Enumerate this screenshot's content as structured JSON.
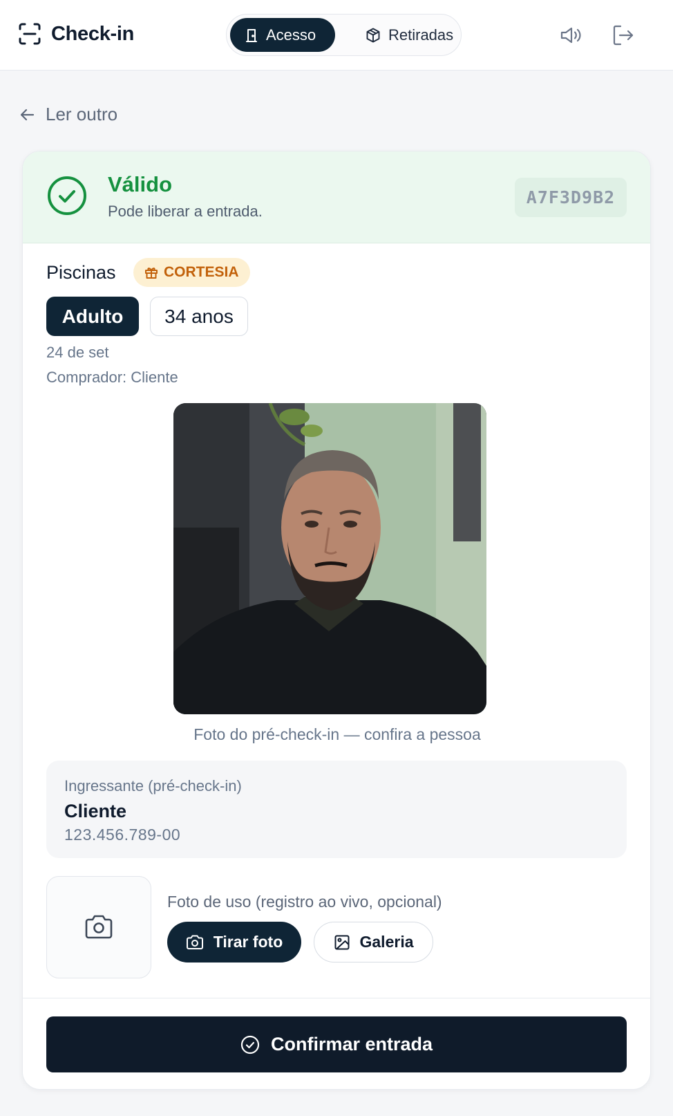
{
  "header": {
    "title": "Check-in",
    "tabs": [
      {
        "label": "Acesso",
        "active": true,
        "icon": "door-icon"
      },
      {
        "label": "Retiradas",
        "active": false,
        "icon": "package-icon"
      }
    ],
    "actions": [
      {
        "icon": "speaker-icon"
      },
      {
        "icon": "logout-icon"
      }
    ]
  },
  "back": {
    "label": "Ler outro"
  },
  "status": {
    "title": "Válido",
    "subtitle": "Pode liberar a entrada.",
    "code": "A7F3D9B2",
    "color": "#15913f",
    "background": "#ebf8ef"
  },
  "ticket": {
    "product": "Piscinas",
    "badge": "CORTESIA",
    "badge_color": "#c2610a",
    "category": "Adulto",
    "age": "34 anos",
    "date": "24 de set",
    "buyer": "Comprador: Cliente"
  },
  "photo": {
    "caption": "Foto do pré-check-in — confira a pessoa"
  },
  "entrant": {
    "label": "Ingressante (pré-check-in)",
    "name": "Cliente",
    "document": "123.456.789-00"
  },
  "usage_photo": {
    "label": "Foto de uso (registro ao vivo, opcional)",
    "take_photo": "Tirar foto",
    "gallery": "Galeria"
  },
  "confirm": {
    "label": "Confirmar entrada"
  },
  "colors": {
    "primary_dark": "#0f2536",
    "page_bg": "#f5f6f8"
  }
}
